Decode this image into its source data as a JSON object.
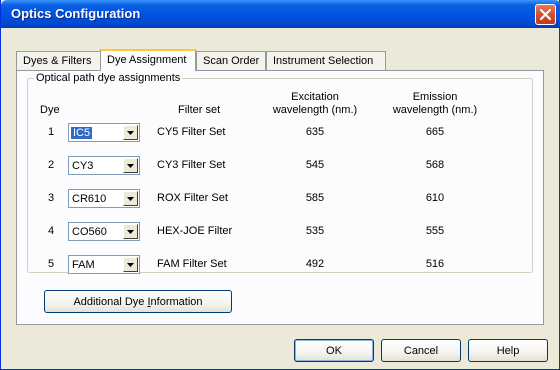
{
  "window": {
    "title": "Optics Configuration",
    "close_icon": "close-icon"
  },
  "tabs": [
    {
      "label": "Dyes & Filters",
      "active": false
    },
    {
      "label": "Dye Assignment",
      "active": true
    },
    {
      "label": "Scan Order",
      "active": false
    },
    {
      "label": "Instrument Selection",
      "active": false
    }
  ],
  "group": {
    "label": "Optical path dye assignments",
    "headers": {
      "dye": "Dye",
      "filter_set": "Filter set",
      "excitation": [
        "Excitation",
        "wavelength (nm.)"
      ],
      "emission": [
        "Emission",
        "wavelength (nm.)"
      ]
    },
    "rows": [
      {
        "num": "1",
        "dye": "IC5",
        "filter": "CY5 Filter Set",
        "excitation": "635",
        "emission": "665",
        "selected": true
      },
      {
        "num": "2",
        "dye": "CY3",
        "filter": "CY3 Filter Set",
        "excitation": "545",
        "emission": "568",
        "selected": false
      },
      {
        "num": "3",
        "dye": "CR610",
        "filter": "ROX Filter Set",
        "excitation": "585",
        "emission": "610",
        "selected": false
      },
      {
        "num": "4",
        "dye": "CO560",
        "filter": "HEX-JOE Filter",
        "excitation": "535",
        "emission": "555",
        "selected": false
      },
      {
        "num": "5",
        "dye": "FAM",
        "filter": "FAM Filter Set",
        "excitation": "492",
        "emission": "516",
        "selected": false
      }
    ]
  },
  "buttons": {
    "additional": {
      "pre": "Additional Dye ",
      "mnemonic": "I",
      "post": "nformation"
    },
    "ok": "OK",
    "cancel": "Cancel",
    "help": "Help"
  },
  "colors": {
    "title_bar": "#0054e3",
    "close_button": "#d4502a",
    "selection": "#316ac5",
    "active_tab_accent": "#ffc83c"
  }
}
